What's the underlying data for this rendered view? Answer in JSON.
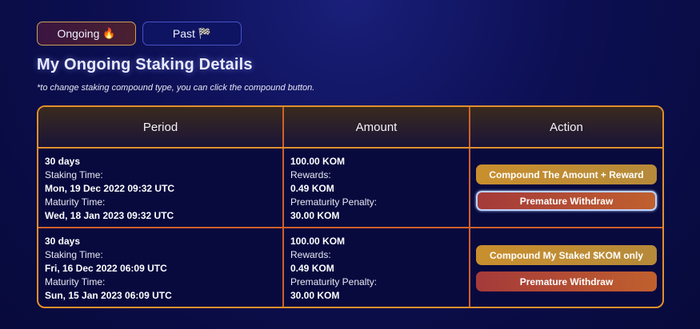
{
  "tabs": [
    {
      "label": "Ongoing",
      "emoji": "🔥",
      "active": true
    },
    {
      "label": "Past",
      "emoji": "🏁",
      "active": false
    }
  ],
  "title": "My Ongoing Staking Details",
  "note": "*to change staking compound type, you can click the compound button.",
  "table": {
    "headers": {
      "period": "Period",
      "amount": "Amount",
      "action": "Action"
    },
    "rows": [
      {
        "duration": "30 days",
        "staking_time_label": "Staking Time:",
        "staking_time": "Mon, 19 Dec 2022 09:32 UTC",
        "maturity_time_label": "Maturity Time:",
        "maturity_time": "Wed, 18 Jan 2023 09:32 UTC",
        "amount": "100.00 KOM",
        "rewards_label": "Rewards:",
        "rewards": "0.49 KOM",
        "penalty_label": "Prematurity Penalty:",
        "penalty": "30.00 KOM",
        "compound_label": "Compound The Amount + Reward",
        "withdraw_label": "Premature Withdraw"
      },
      {
        "duration": "30 days",
        "staking_time_label": "Staking Time:",
        "staking_time": "Fri, 16 Dec 2022 06:09 UTC",
        "maturity_time_label": "Maturity Time:",
        "maturity_time": "Sun, 15 Jan 2023 06:09 UTC",
        "amount": "100.00 KOM",
        "rewards_label": "Rewards:",
        "rewards": "0.49 KOM",
        "penalty_label": "Prematurity Penalty:",
        "penalty": "30.00 KOM",
        "compound_label": "Compound My Staked $KOM only",
        "withdraw_label": "Premature Withdraw"
      }
    ]
  },
  "colors": {
    "accent_border": "#e0902a",
    "compound_button": "#c98f2e",
    "withdraw_button": "#b04a38"
  }
}
